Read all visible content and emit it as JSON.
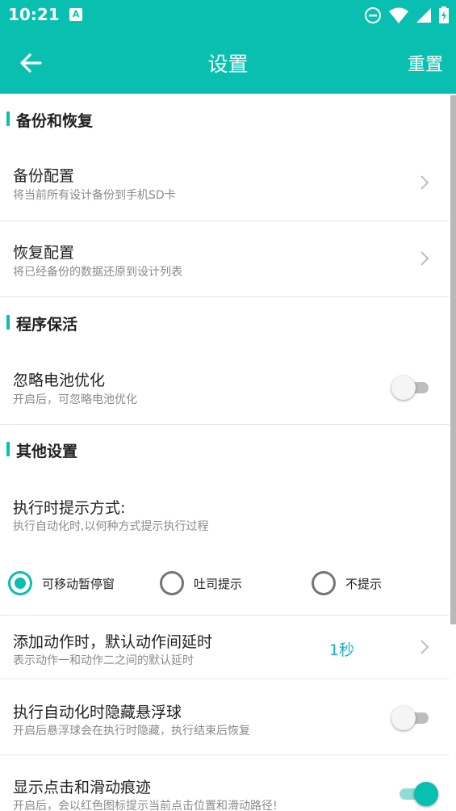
{
  "status": {
    "time": "10:21",
    "notification_badge": "A"
  },
  "header": {
    "title": "设置",
    "reset": "重置",
    "back_icon": "arrow-left-icon"
  },
  "sections": {
    "backup": {
      "title": "备份和恢复",
      "items": [
        {
          "title": "备份配置",
          "subtitle": "将当前所有设计备份到手机SD卡"
        },
        {
          "title": "恢复配置",
          "subtitle": "将已经备份的数据还原到设计列表"
        }
      ]
    },
    "keepalive": {
      "title": "程序保活",
      "items": [
        {
          "title": "忽略电池优化",
          "subtitle": "开启后，可忽略电池优化",
          "enabled": false
        }
      ]
    },
    "other": {
      "title": "其他设置",
      "prompt": {
        "title": "执行时提示方式:",
        "subtitle": "执行自动化时,以何种方式提示执行过程",
        "options": [
          "可移动暂停窗",
          "吐司提示",
          "不提示"
        ],
        "selected": "可移动暂停窗"
      },
      "delay": {
        "title": "添加动作时，默认动作间延时",
        "subtitle": "表示动作一和动作二之间的默认延时",
        "value": "1秒"
      },
      "hide_ball": {
        "title": "执行自动化时隐藏悬浮球",
        "subtitle": "开启后悬浮球会在执行时隐藏，执行结束后恢复",
        "enabled": false
      },
      "show_trace": {
        "title": "显示点击和滑动痕迹",
        "subtitle": "开启后，会以红色图标提示当前点击位置和滑动路径!",
        "enabled": true
      }
    }
  },
  "colors": {
    "accent": "#09c0b0",
    "value_text": "#17b3c8"
  }
}
